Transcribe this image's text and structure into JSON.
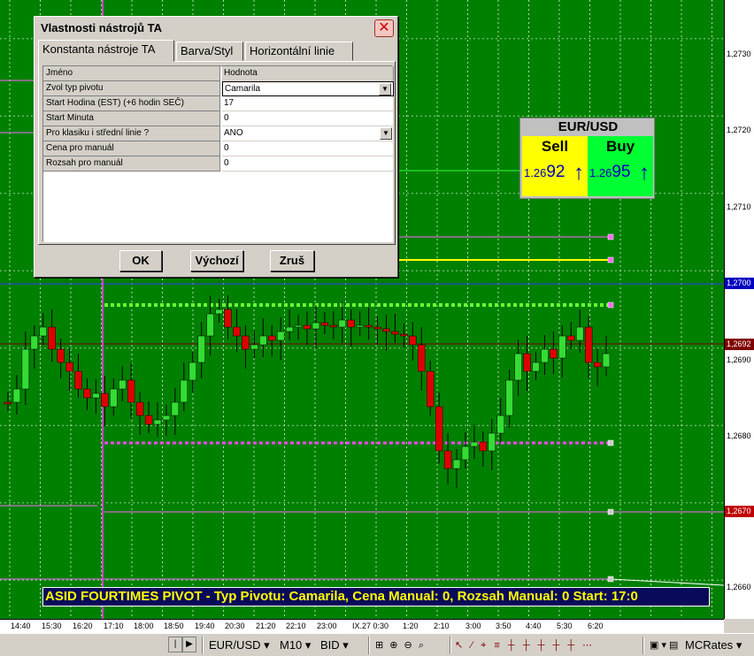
{
  "dialog": {
    "title": "Vlastnosti nástrojů TA",
    "close_glyph": "✕",
    "tabs": [
      "Konstanta nástroje TA",
      "Barva/Styl",
      "Horizontální linie"
    ],
    "header": {
      "name": "Jméno",
      "value": "Hodnota"
    },
    "rows": [
      {
        "name": "Zvol typ pivotu",
        "value": "Camarila",
        "dropdown": true
      },
      {
        "name": "Start Hodina (EST) (+6 hodin SEČ)",
        "value": "17",
        "dropdown": false
      },
      {
        "name": "Start Minuta",
        "value": "0",
        "dropdown": false
      },
      {
        "name": "Pro klasiku i střední linie ?",
        "value": "ANO",
        "dropdown": true
      },
      {
        "name": "Cena pro manuál",
        "value": "0",
        "dropdown": false
      },
      {
        "name": "Rozsah pro manuál",
        "value": "0",
        "dropdown": false
      }
    ],
    "buttons": {
      "ok": "OK",
      "default": "Výchozí",
      "cancel": "Zruš"
    }
  },
  "pricebox": {
    "title": "EUR/USD",
    "sell_label": "Sell",
    "buy_label": "Buy",
    "sell_prefix": "1.26",
    "sell_big": "92",
    "buy_prefix": "1.26",
    "buy_big": "95",
    "arrow": "↑"
  },
  "banner": "ASID FOURTIMES PIVOT  -  Typ Pivotu: Camarila, Cena Manual: 0, Rozsah Manual: 0     Start: 17:0",
  "yaxis": {
    "ticks": [
      "1,2730",
      "1,2720",
      "1,2710",
      "1,2690",
      "1,2680",
      "1,2660"
    ],
    "tags": [
      {
        "label": "1,2700",
        "color": "#0000c0"
      },
      {
        "label": "1,2692",
        "color": "#800000"
      },
      {
        "label": "1,2670",
        "color": "#c00000"
      }
    ]
  },
  "xaxis": {
    "ticks": [
      "14:40",
      "15:30",
      "16:20",
      "17:10",
      "18:00",
      "18:50",
      "19:40",
      "20:30",
      "21:20",
      "22:10",
      "23:00",
      "IX.27 0:30",
      "1:20",
      "2:10",
      "3:00",
      "3:50",
      "4:40",
      "5:30",
      "6:20"
    ]
  },
  "toolbar": {
    "symbol": "EUR/USD",
    "timeframe": "M10",
    "price_type": "BID",
    "rates": "MCRates",
    "dropdown_glyph": "▾"
  },
  "colors": {
    "chart_bg": "#008000",
    "bull": "#33dd33",
    "bear": "#dd0000",
    "pivot_magenta": "#ff44ff",
    "pivot_yellow": "#ffff00"
  },
  "chart_data": {
    "type": "candlestick",
    "symbol": "EUR/USD",
    "timeframe": "M10",
    "ylim": [
      1.2655,
      1.2735
    ],
    "levels": [
      1.2697,
      1.2679,
      1.2692,
      1.27,
      1.267
    ]
  }
}
